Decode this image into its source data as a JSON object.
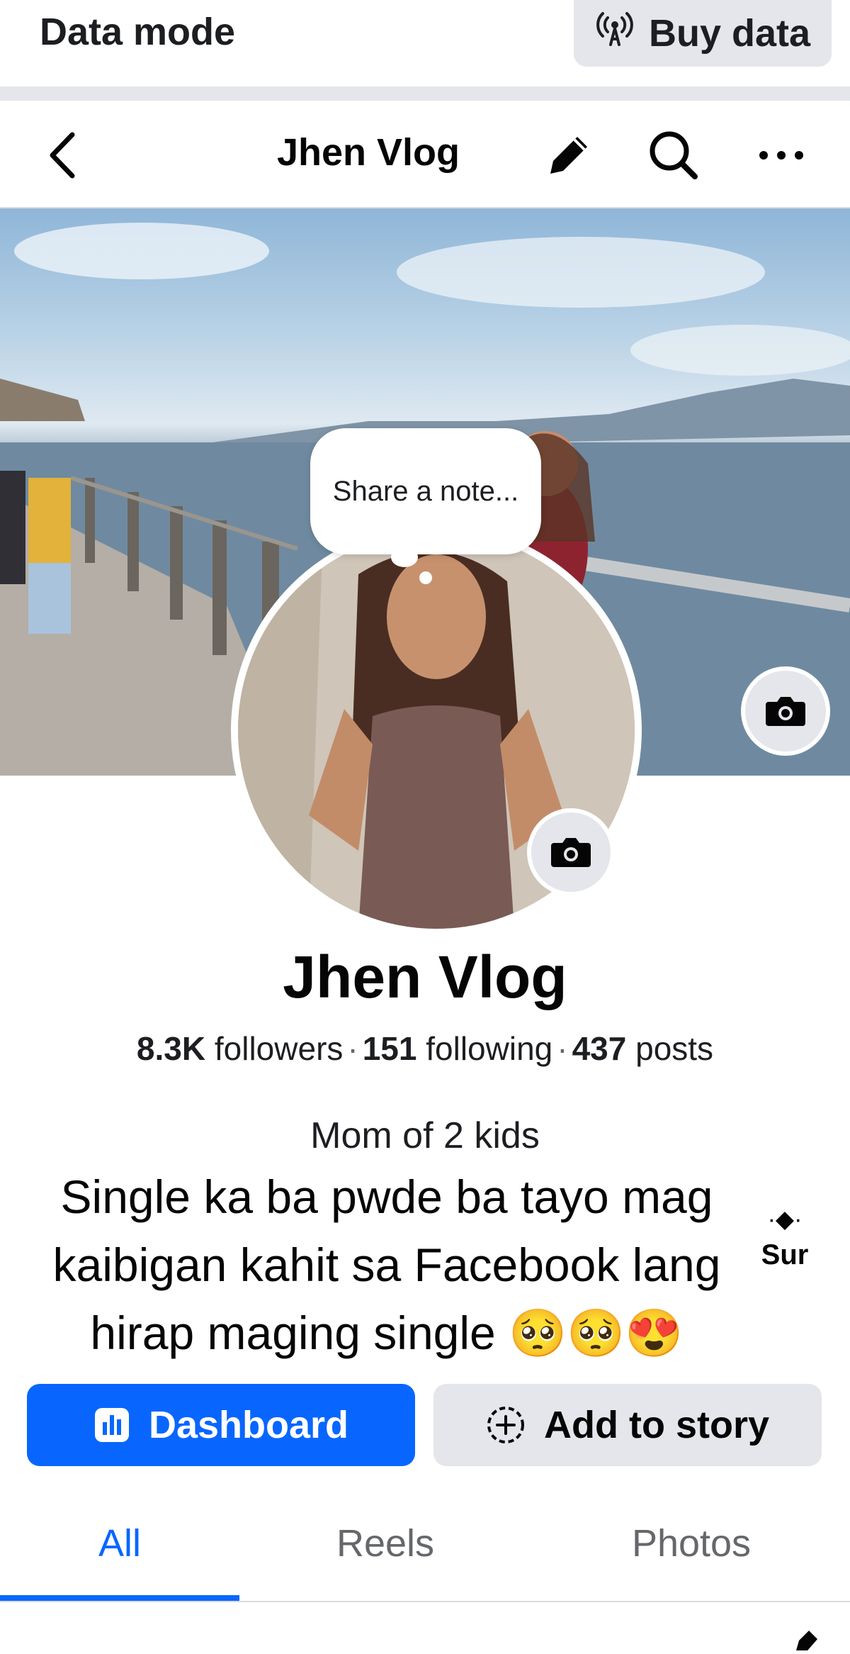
{
  "data_banner": {
    "label": "Data mode",
    "buy_data": "Buy data"
  },
  "header": {
    "title": "Jhen Vlog",
    "icons": [
      "back-icon",
      "pencil-icon",
      "search-icon",
      "more-icon"
    ]
  },
  "cover": {
    "camera_icon": "camera-icon"
  },
  "note": {
    "placeholder": "Share a note..."
  },
  "profile": {
    "name": "Jhen Vlog",
    "followers_count": "8.3K",
    "followers_label": "followers",
    "following_count": "151",
    "following_label": "following",
    "posts_count": "437",
    "posts_label": "posts",
    "bio_line1": "Mom of 2 kids",
    "bio_body": "Single ka ba pwde ba tayo mag kaibigan kahit sa Facebook lang hirap maging single 🥺🥺😍",
    "see_more_label": "Sur"
  },
  "actions": {
    "dashboard": "Dashboard",
    "add_to_story": "Add to story"
  },
  "tabs": [
    {
      "label": "All",
      "active": true
    },
    {
      "label": "Reels",
      "active": false
    },
    {
      "label": "Photos",
      "active": false
    }
  ],
  "colors": {
    "accent": "#0866ff",
    "button_gray": "#e4e6eb",
    "text_secondary": "#65676b"
  }
}
